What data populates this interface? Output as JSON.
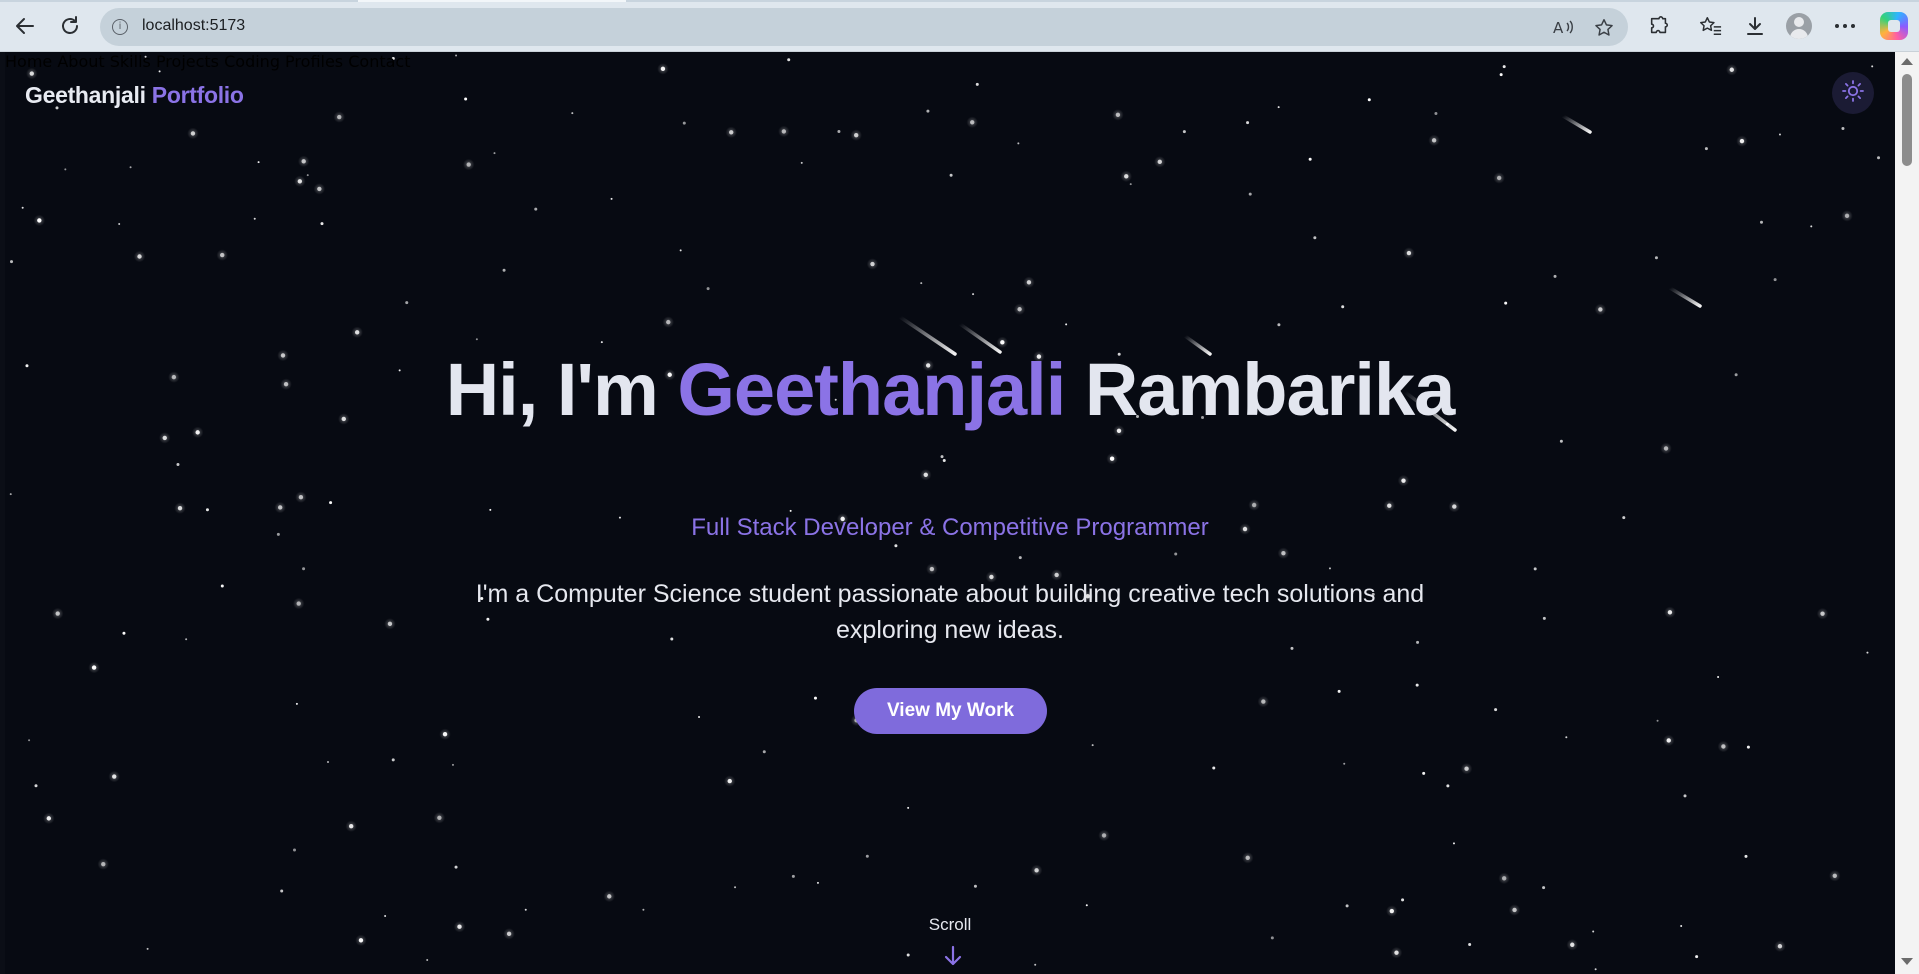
{
  "browser": {
    "url": "localhost:5173",
    "icons": {
      "back": "back-arrow-icon",
      "reload": "reload-icon",
      "site_info": "info-icon",
      "read_aloud": "read-aloud-icon",
      "favorite": "star-icon",
      "extensions": "puzzle-icon",
      "favorites": "favorites-icon",
      "downloads": "download-icon",
      "profile": "avatar",
      "more": "more-icon",
      "copilot": "copilot-icon"
    }
  },
  "site": {
    "brand_name": "Geethanjali",
    "brand_accent": "Portfolio",
    "nav": [
      "Home",
      "About",
      "Skills",
      "Projects",
      "Coding Profiles",
      "Contact"
    ],
    "theme_toggle_icon": "sun-icon"
  },
  "hero": {
    "greeting": "Hi, I'm",
    "first_name": "Geethanjali",
    "last_name": "Rambarika",
    "subtitle": "Full Stack Developer & Competitive Programmer",
    "description": "I'm a Computer Science student passionate about building creative tech solutions and exploring new ideas.",
    "cta_label": "View My Work",
    "scroll_label": "Scroll"
  },
  "colors": {
    "background": "#070a12",
    "accent": "#8b73e6",
    "button": "#7f6bdc",
    "text": "#e3e6ef"
  }
}
